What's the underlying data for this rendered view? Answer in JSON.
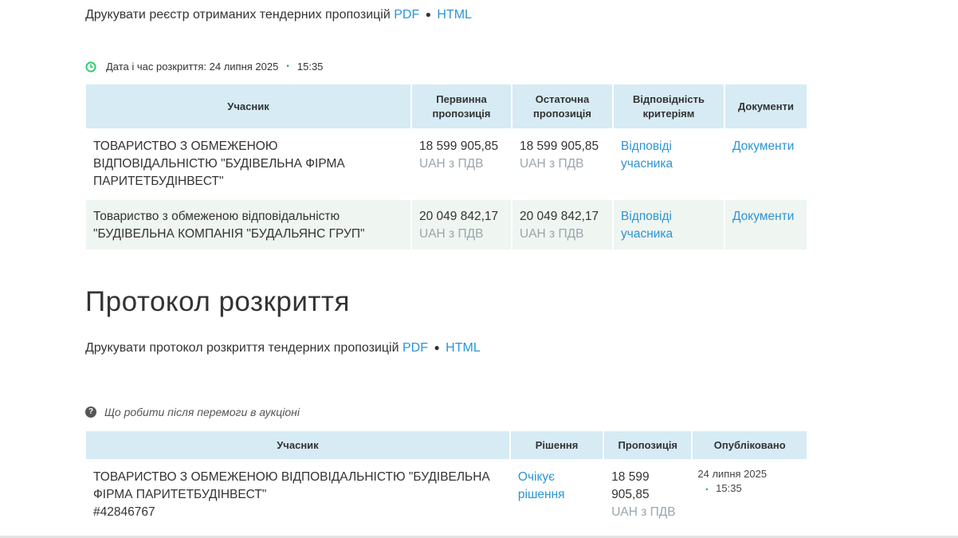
{
  "registry": {
    "print_text": "Друкувати реєстр отриманих тендерних пропозицій",
    "pdf": "PDF",
    "html": "HTML",
    "separator": "●"
  },
  "opening": {
    "label": "Дата і час розкриття: 24 липня 2025",
    "dot": "•",
    "time": "15:35",
    "headers": {
      "participant": "Учасник",
      "initial": "Первинна пропозиція",
      "final": "Остаточна пропозиція",
      "criteria": "Відповідність критеріям",
      "documents": "Документи"
    },
    "rows": [
      {
        "participant": "ТОВАРИСТВО З ОБМЕЖЕНОЮ ВІДПОВІДАЛЬНІСТЮ \"БУДІВЕЛЬНА ФІРМА ПАРИТЕТБУДІНВЕСТ\"",
        "initial": "18 599 905,85",
        "initial_cur": "UAH з ПДВ",
        "final": "18 599 905,85",
        "final_cur": "UAH з ПДВ",
        "criteria": "Відповіді учасника",
        "documents": "Документи"
      },
      {
        "participant": "Товариство з обмеженою відповідальністю \"БУДІВЕЛЬНА КОМПАНІЯ \"БУДАЛЬЯНС ГРУП\"",
        "initial": "20 049 842,17",
        "initial_cur": "UAH з ПДВ",
        "final": "20 049 842,17",
        "final_cur": "UAH з ПДВ",
        "criteria": "Відповіді учасника",
        "documents": "Документи"
      }
    ]
  },
  "protocol": {
    "title": "Протокол розкриття",
    "print_text": "Друкувати протокол розкриття тендерних пропозицій",
    "pdf": "PDF",
    "html": "HTML",
    "separator": "●"
  },
  "awards": {
    "help": "Що робити після перемоги в аукціоні",
    "help_icon": "?",
    "headers": {
      "participant": "Учасник",
      "decision": "Рішення",
      "offer": "Пропозиція",
      "published": "Опубліковано"
    },
    "rows": [
      {
        "participant": "ТОВАРИСТВО З ОБМЕЖЕНОЮ ВІДПОВІДАЛЬНІСТЮ \"БУДІВЕЛЬНА ФІРМА ПАРИТЕТБУДІНВЕСТ\"",
        "code": "#42846767",
        "decision": "Очікує рішення",
        "offer": "18 599 905,85",
        "offer_cur": "UAH з ПДВ",
        "pub_date": "24 липня 2025",
        "pub_dot": "•",
        "pub_time": "15:35"
      }
    ]
  },
  "colors": {
    "link": "#2b95d4",
    "header_bg": "#d6ebf4",
    "alt_row": "#eff5f1",
    "clock": "#2ecc71"
  }
}
